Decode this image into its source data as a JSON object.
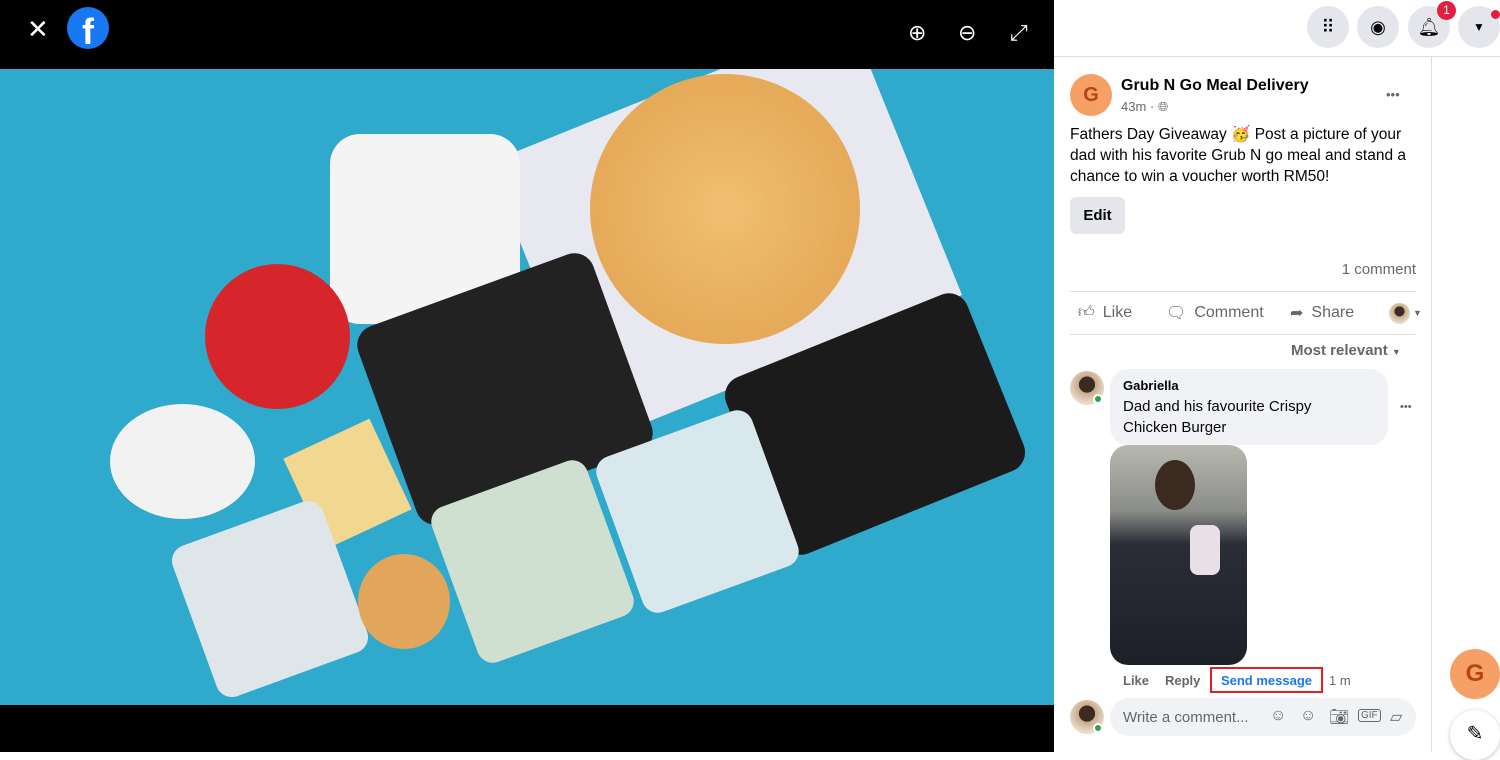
{
  "viewer": {
    "close_icon": "close-icon",
    "logo": "facebook-logo",
    "zoom_in_icon": "zoom-in-icon",
    "zoom_out_icon": "zoom-out-icon",
    "fullscreen_icon": "fullscreen-icon",
    "photo_description": "food"
  },
  "topbar": {
    "notifications_count": "1"
  },
  "post": {
    "avatar_letter": "G",
    "author": "Grub N Go Meal Delivery",
    "time": "43m ·",
    "text": "Fathers Day Giveaway 🥳 Post a picture of your dad with his favorite Grub N go meal and stand a chance to win a voucher worth RM50!",
    "edit_label": "Edit",
    "comment_count": "1 comment",
    "more": "•••"
  },
  "actions": {
    "like": "Like",
    "comment": "Comment",
    "share": "Share"
  },
  "sort": {
    "label": "Most relevant"
  },
  "comment": {
    "author": "Gabriella",
    "text": "Dad and his favourite Crispy Chicken Burger",
    "like": "Like",
    "reply": "Reply",
    "send_message": "Send message",
    "time": "1 m",
    "more": "•••"
  },
  "composer": {
    "placeholder": "Write a comment..."
  },
  "colors": {
    "accent": "#1877f2",
    "highlight": "#e41e1e",
    "avatar": "#f7a066"
  }
}
